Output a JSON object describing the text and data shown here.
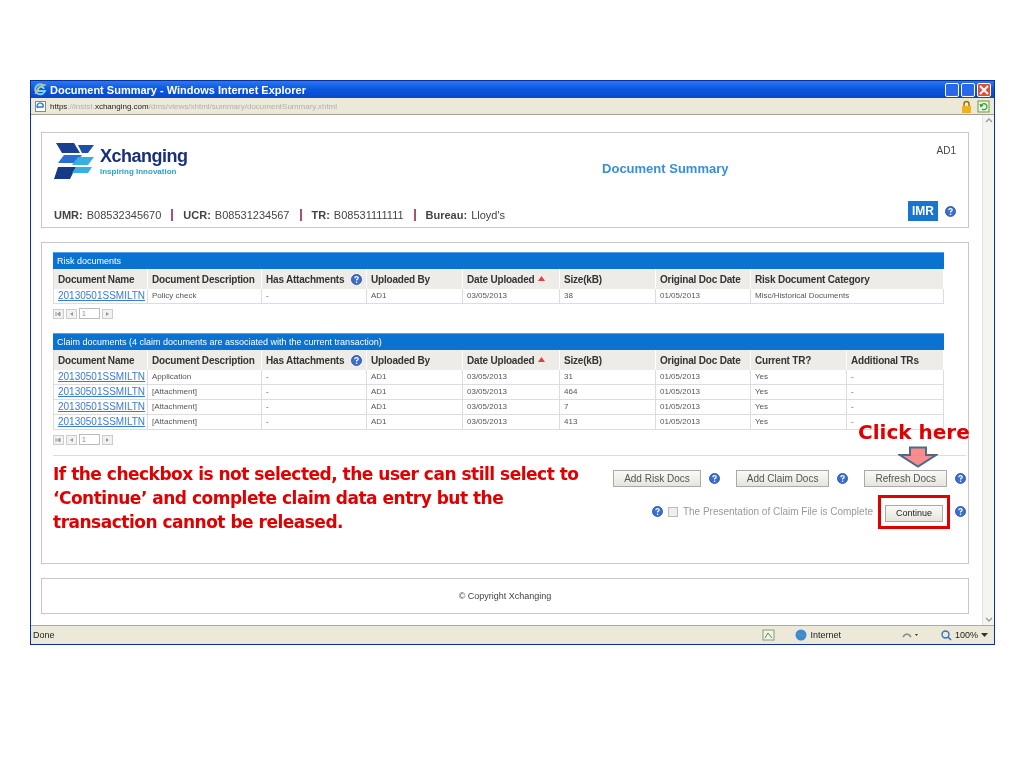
{
  "window": {
    "title": "Document Summary - Windows Internet Explorer"
  },
  "address_bar": {
    "url": "**https**://instst.**xchanging.com**/dms/views/xhtml/summary/documentSummary.xhtml"
  },
  "header": {
    "logo_name": "Xchanging",
    "logo_tagline": "Inspiring Innovation",
    "title": "Document Summary",
    "user": "AD1",
    "badge": "IMR",
    "refs": [
      {
        "label": "UMR:",
        "value": "B08532345670"
      },
      {
        "label": "UCR:",
        "value": "B08531234567"
      },
      {
        "label": "TR:",
        "value": "B08531111111"
      },
      {
        "label": "Bureau:",
        "value": "Lloyd's"
      }
    ]
  },
  "risk_documents": {
    "title": "Risk documents",
    "columns": [
      {
        "label": "Document Name",
        "help": false,
        "sorted": false
      },
      {
        "label": "Document Description",
        "help": false,
        "sorted": false
      },
      {
        "label": "Has Attachments",
        "help": true,
        "sorted": false
      },
      {
        "label": "Uploaded By",
        "help": false,
        "sorted": false
      },
      {
        "label": "Date Uploaded",
        "help": false,
        "sorted": true
      },
      {
        "label": "Size(kB)",
        "help": false,
        "sorted": false
      },
      {
        "label": "Original Doc Date",
        "help": false,
        "sorted": false
      },
      {
        "label": "Risk Document Category",
        "help": false,
        "sorted": false
      }
    ],
    "rows": [
      [
        "20130501SSMILTN",
        "Policy check",
        "-",
        "AD1",
        "03/05/2013",
        "38",
        "01/05/2013",
        "Misc/Historical Documents"
      ]
    ],
    "pager": {
      "page": "1"
    }
  },
  "claim_documents": {
    "title": "Claim documents (4 claim documents are associated with the current transaction)",
    "columns": [
      {
        "label": "Document Name",
        "help": false,
        "sorted": false
      },
      {
        "label": "Document Description",
        "help": false,
        "sorted": false
      },
      {
        "label": "Has Attachments",
        "help": true,
        "sorted": false
      },
      {
        "label": "Uploaded By",
        "help": false,
        "sorted": false
      },
      {
        "label": "Date Uploaded",
        "help": false,
        "sorted": true
      },
      {
        "label": "Size(kB)",
        "help": false,
        "sorted": false
      },
      {
        "label": "Original Doc Date",
        "help": false,
        "sorted": false
      },
      {
        "label": "Current TR?",
        "help": false,
        "sorted": false
      },
      {
        "label": "Additional TRs",
        "help": false,
        "sorted": false
      }
    ],
    "rows": [
      [
        "20130501SSMILTN",
        "Application",
        "-",
        "AD1",
        "03/05/2013",
        "31",
        "01/05/2013",
        "Yes",
        "-"
      ],
      [
        "20130501SSMILTN",
        "[Attachment]",
        "-",
        "AD1",
        "03/05/2013",
        "464",
        "01/05/2013",
        "Yes",
        "-"
      ],
      [
        "20130501SSMILTN",
        "[Attachment]",
        "-",
        "AD1",
        "03/05/2013",
        "7",
        "01/05/2013",
        "Yes",
        "-"
      ],
      [
        "20130501SSMILTN",
        "[Attachment]",
        "-",
        "AD1",
        "03/05/2013",
        "413",
        "01/05/2013",
        "Yes",
        "-"
      ]
    ],
    "pager": {
      "page": "1"
    }
  },
  "buttons": [
    {
      "label": "Add Risk Docs"
    },
    {
      "label": "Add Claim Docs"
    },
    {
      "label": "Refresh Docs"
    }
  ],
  "completion": {
    "label": "The Presentation of Claim File is Complete",
    "checked": false,
    "disabled": true
  },
  "continue_button": {
    "label": "Continue"
  },
  "footer": {
    "text": "© Copyright Xchanging"
  },
  "status_bar": {
    "status": "Done",
    "zone": "Internet",
    "zoom": "100%"
  },
  "annotations": [
    {
      "kind": "note",
      "text": "If the checkbox is not selected, the user can still select to ‘Continue’ and complete claim data entry but the transaction cannot be released."
    },
    {
      "kind": "callout",
      "text": "Click here"
    }
  ]
}
